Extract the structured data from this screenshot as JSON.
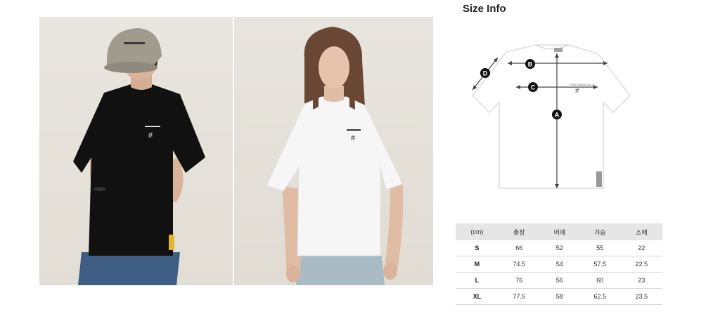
{
  "size_info": {
    "title": "Size Info",
    "markers": {
      "a": "A",
      "b": "B",
      "c": "C",
      "d": "D"
    },
    "shirt_logo_text": "FIRSTMANSTALLS",
    "shirt_logo_symbol": "#"
  },
  "table": {
    "headers": [
      "(cm)",
      "총장",
      "어깨",
      "가슴",
      "소매"
    ],
    "rows": [
      [
        "S",
        "66",
        "52",
        "55",
        "22"
      ],
      [
        "M",
        "74.5",
        "54",
        "57.5",
        "22.5"
      ],
      [
        "L",
        "76",
        "56",
        "60",
        "23"
      ],
      [
        "XL",
        "77.5",
        "58",
        "62.5",
        "23.5"
      ]
    ]
  },
  "photos": {
    "left": {
      "shirt_color": "#111111",
      "print_symbol": "#"
    },
    "right": {
      "shirt_color": "#f6f6f6",
      "print_symbol": "#"
    }
  }
}
